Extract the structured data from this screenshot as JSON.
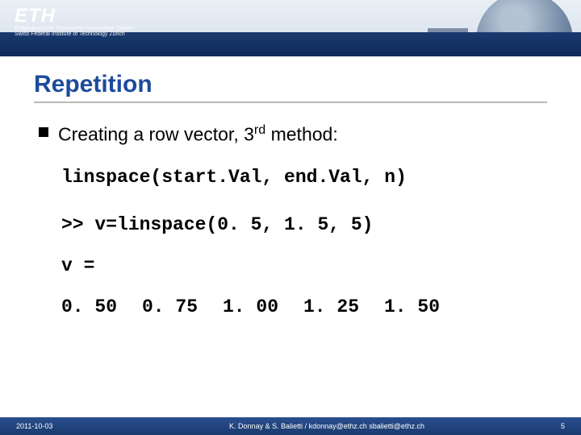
{
  "header": {
    "logo_title": "ETH",
    "logo_sub1": "Eidgenössische Technische Hochschule Zürich",
    "logo_sub2": "Swiss Federal Institute of Technology Zurich"
  },
  "title": "Repetition",
  "bullet": {
    "pre": "Creating a row vector, 3",
    "sup": "rd",
    "post": " method:"
  },
  "code": {
    "signature": "linspace(start.Val, end.Val, n)",
    "example": ">> v=linspace(0. 5, 1. 5, 5)",
    "out_label": "v =",
    "out_values": [
      "0. 50",
      "0. 75",
      "1. 00",
      "1. 25",
      "1. 50"
    ]
  },
  "footer": {
    "date": "2011-10-03",
    "credits": "K. Donnay & S. Balietti / kdonnay@ethz.ch  sbalietti@ethz.ch",
    "pagenum": "5"
  }
}
